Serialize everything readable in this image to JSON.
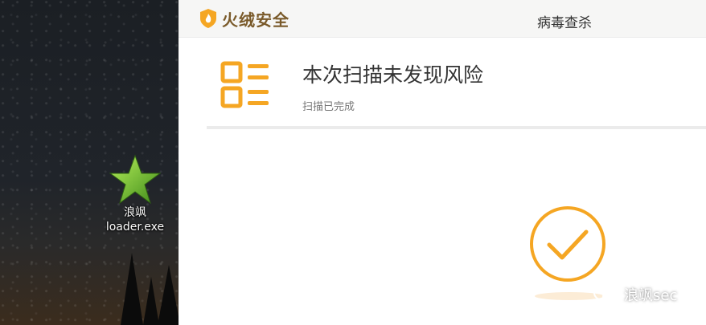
{
  "desktop": {
    "icon": {
      "name": "star-app-icon",
      "label_line1": "浪飒",
      "label_line2": "loader.exe"
    }
  },
  "app": {
    "brand_name": "火绒安全",
    "page_title": "病毒查杀",
    "scan_result": {
      "title": "本次扫描未发现风险",
      "subtitle": "扫描已完成"
    },
    "accent_color": "#f5a623"
  },
  "watermark": {
    "text": "浪飒sec"
  }
}
